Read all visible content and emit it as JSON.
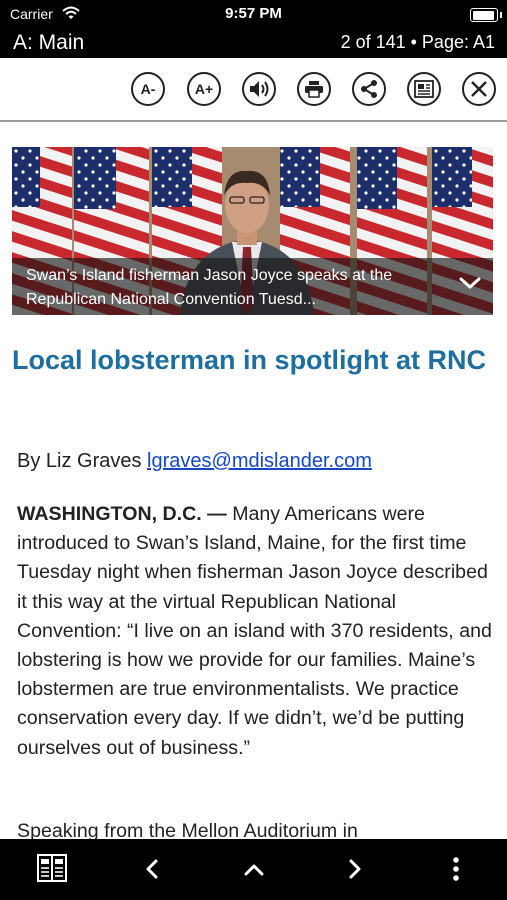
{
  "status": {
    "carrier": "Carrier",
    "time": "9:57 PM",
    "battery_level": 1.0
  },
  "header": {
    "section": "A: Main",
    "page_info": "2 of 141 • Page: A1"
  },
  "toolbar": {
    "font_decrease_label": "A-",
    "font_increase_label": "A+",
    "icons": [
      "speaker-icon",
      "print-icon",
      "share-icon",
      "article-view-icon",
      "close-icon"
    ]
  },
  "photo": {
    "caption": "Swan’s Island fisherman Jason Joyce speaks at the Republican National Convention Tuesd..."
  },
  "article": {
    "headline": "Local lobsterman in spotlight at RNC",
    "by_prefix": "By Liz Graves",
    "email": "lgraves@mdislander.com",
    "dateline": "WASHINGTON, D.C. —",
    "paragraph1": "Many Americans were introduced to Swan’s Island, Maine, for the first time Tuesday night when fisherman Jason Joyce described it this way at the virtual Republican National Convention: “I live on an island with 370 residents, and lobstering is how we provide for our families. Maine’s lobstermen are true environmentalists. We practice conservation every day. If we didn’t, we’d be putting ourselves out of business.”",
    "paragraph2": "Speaking from the Mellon Auditorium in"
  },
  "bottom_nav": {
    "icons": [
      "pages-icon",
      "chevron-left-icon",
      "chevron-up-icon",
      "chevron-right-icon",
      "more-vertical-icon"
    ]
  }
}
